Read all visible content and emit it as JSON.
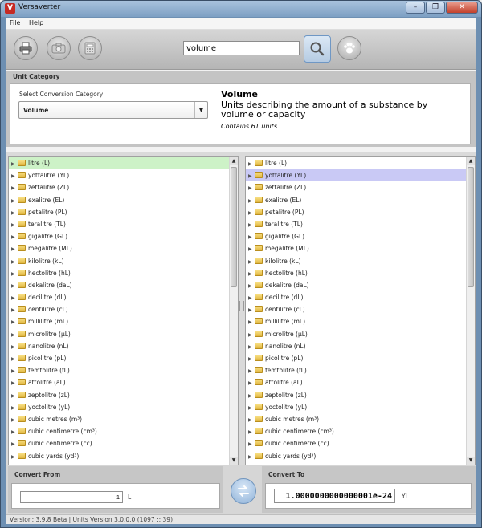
{
  "window": {
    "title": "Versaverter",
    "controls": [
      "–",
      "❐",
      "✕"
    ]
  },
  "menu": {
    "file": "File",
    "help": "Help"
  },
  "toolbar": {
    "icons": [
      "print-icon",
      "camera-icon",
      "calculator-icon"
    ],
    "search_value": "volume",
    "search_icon": "search-icon",
    "paw_icon": "paw-icon"
  },
  "category": {
    "section_label": "Unit Category",
    "select_label": "Select Conversion Category",
    "selected": "Volume",
    "name": "Volume",
    "description": "Units describing the amount of a substance by volume or capacity",
    "count": "Contains 61 units"
  },
  "units": [
    "litre (L)",
    "yottalitre (YL)",
    "zettalitre (ZL)",
    "exalitre (EL)",
    "petalitre (PL)",
    "teralitre (TL)",
    "gigalitre (GL)",
    "megalitre (ML)",
    "kilolitre (kL)",
    "hectolitre (hL)",
    "dekalitre (daL)",
    "decilitre (dL)",
    "centilitre (cL)",
    "millilitre (mL)",
    "microlitre (µL)",
    "nanolitre (nL)",
    "picolitre (pL)",
    "femtolitre (fL)",
    "attolitre (aL)",
    "zeptolitre (zL)",
    "yoctolitre (yL)",
    "cubic metres (m³)",
    "cubic centimetre (cm³)",
    "cubic centimetre (cc)",
    "cubic yards (yd³)"
  ],
  "left_selected_index": 0,
  "right_selected_index": 1,
  "convert_from": {
    "label": "Convert From",
    "value": "1",
    "unit": "L"
  },
  "convert_to": {
    "label": "Convert To",
    "value": "1.0000000000000001e-24",
    "unit": "YL"
  },
  "status": "Version: 3.9.8 Beta | Units Version 3.0.0.0 (1097 :: 39)",
  "colors": {
    "left_selection": "#cdf2c7",
    "right_selection": "#c9c9f5",
    "title_bar": "#7d9fc3"
  }
}
